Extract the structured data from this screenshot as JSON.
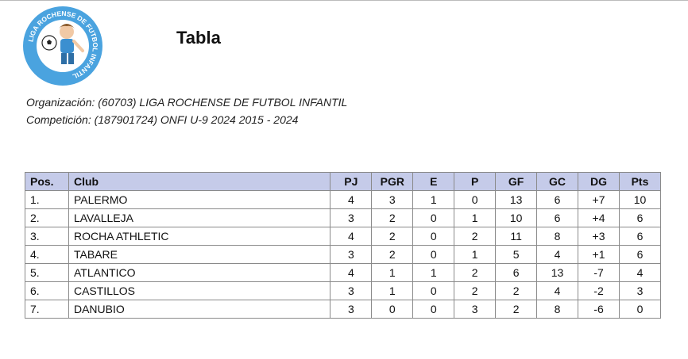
{
  "header": {
    "logo_text": "LIGA ROCHENSE DE FUTBOL INFANTIL",
    "title": "Tabla"
  },
  "meta": {
    "organizacion": "Organización: (60703) LIGA ROCHENSE DE FUTBOL INFANTIL",
    "competicion": "Competición: (187901724) ONFI U-9 2024 2015 - 2024"
  },
  "table": {
    "headers": [
      "Pos.",
      "Club",
      "PJ",
      "PGR",
      "E",
      "P",
      "GF",
      "GC",
      "DG",
      "Pts"
    ],
    "rows": [
      [
        "1.",
        "PALERMO",
        "4",
        "3",
        "1",
        "0",
        "13",
        "6",
        "+7",
        "10"
      ],
      [
        "2.",
        "LAVALLEJA",
        "3",
        "2",
        "0",
        "1",
        "10",
        "6",
        "+4",
        "6"
      ],
      [
        "3.",
        "ROCHA ATHLETIC",
        "4",
        "2",
        "0",
        "2",
        "11",
        "8",
        "+3",
        "6"
      ],
      [
        "4.",
        "TABARE",
        "3",
        "2",
        "0",
        "1",
        "5",
        "4",
        "+1",
        "6"
      ],
      [
        "5.",
        "ATLANTICO",
        "4",
        "1",
        "1",
        "2",
        "6",
        "13",
        "-7",
        "4"
      ],
      [
        "6.",
        "CASTILLOS",
        "3",
        "1",
        "0",
        "2",
        "2",
        "4",
        "-2",
        "3"
      ],
      [
        "7.",
        "DANUBIO",
        "3",
        "0",
        "0",
        "3",
        "2",
        "8",
        "-6",
        "0"
      ]
    ]
  },
  "colors": {
    "header_bg": "#c5cbe9",
    "logo_blue": "#4aa3df"
  }
}
